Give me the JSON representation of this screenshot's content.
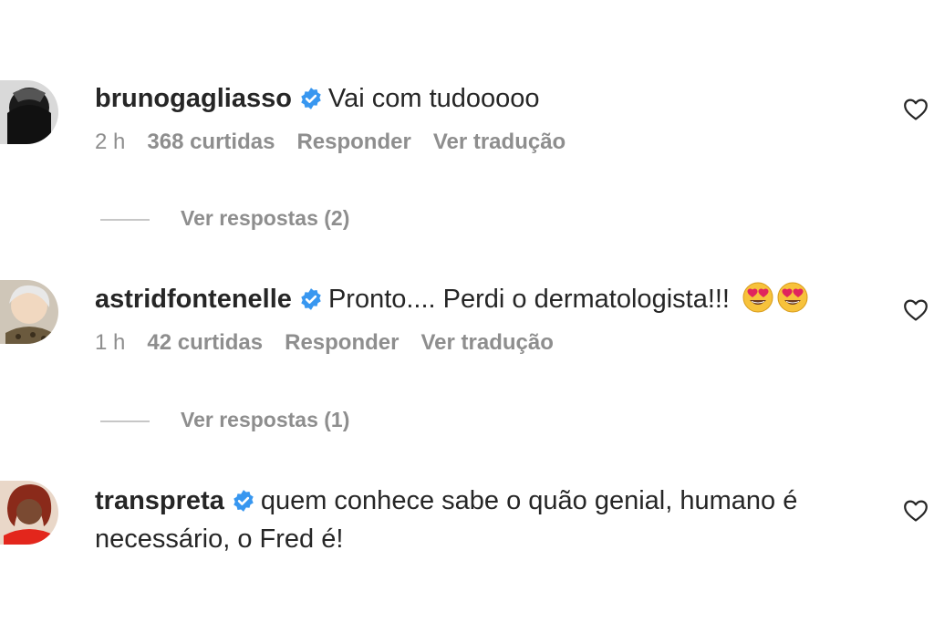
{
  "comments": [
    {
      "username": "brunogagliasso",
      "text": "Vai com tudooooo",
      "time": "2 h",
      "likes": "368 curtidas",
      "reply_label": "Responder",
      "translate_label": "Ver tradução",
      "view_replies": "Ver respostas (2)"
    },
    {
      "username": "astridfontenelle",
      "text": "Pronto.... Perdi o dermatologista!!!",
      "emojis": [
        "heart-eyes-emoji",
        "heart-eyes-emoji"
      ],
      "time": "1 h",
      "likes": "42 curtidas",
      "reply_label": "Responder",
      "translate_label": "Ver tradução",
      "view_replies": "Ver respostas (1)"
    },
    {
      "username": "transpreta",
      "text": "quem conhece sabe o quão genial, humano é necessário, o Fred é!"
    }
  ],
  "colors": {
    "text": "#262626",
    "secondary": "#8e8e8e",
    "verified": "#3897f0"
  }
}
